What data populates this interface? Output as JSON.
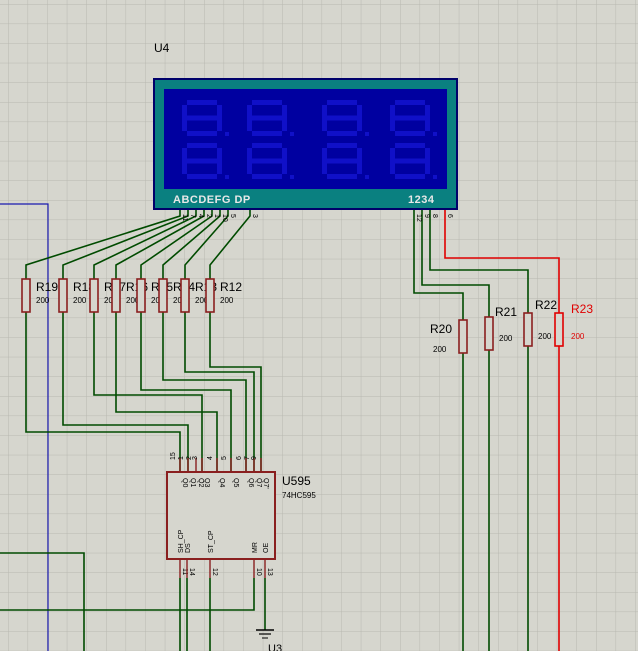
{
  "colors": {
    "background": "#d6d6ce",
    "grid": "#b8b8b0",
    "wire": "#004b00",
    "wire_red": "#e00000",
    "component": "#8a1f1f",
    "text": "#000000",
    "lcd_frame": "#0a8080",
    "lcd_screen": "#0000a0",
    "lcd_segment": "#1010c8",
    "lcd_label": "#e8e8e8",
    "blue_line": "#1a1ab0"
  },
  "display": {
    "ref": "U4",
    "segment_label": "ABCDEFG DP",
    "digit_label": "1234",
    "segment_pins": [
      "11",
      "7",
      "4",
      "2",
      "1",
      "10",
      "5",
      "3"
    ],
    "digit_pins": [
      "12",
      "9",
      "8",
      "6"
    ]
  },
  "resistors": [
    {
      "ref": "R19",
      "value": "200"
    },
    {
      "ref": "R18",
      "value": "200"
    },
    {
      "ref": "R17",
      "value": "200"
    },
    {
      "ref": "R16",
      "value": "200"
    },
    {
      "ref": "R15",
      "value": "200"
    },
    {
      "ref": "R14",
      "value": "200"
    },
    {
      "ref": "R13",
      "value": "200"
    },
    {
      "ref": "R12",
      "value": "200"
    },
    {
      "ref": "R20",
      "value": "200"
    },
    {
      "ref": "R21",
      "value": "200"
    },
    {
      "ref": "R22",
      "value": "200"
    },
    {
      "ref": "R23",
      "value": "200"
    }
  ],
  "chip": {
    "ref": "U595",
    "part": "74HC595",
    "top_pins": [
      {
        "num": "15",
        "name": "Q0"
      },
      {
        "num": "1",
        "name": "Q1"
      },
      {
        "num": "2",
        "name": "Q2"
      },
      {
        "num": "3",
        "name": "Q3"
      },
      {
        "num": "4",
        "name": "Q4"
      },
      {
        "num": "5",
        "name": "Q5"
      },
      {
        "num": "6",
        "name": "Q6"
      },
      {
        "num": "7",
        "name": "Q7"
      },
      {
        "num": "9",
        "name": "Q7'"
      }
    ],
    "bottom_pins": [
      {
        "num": "11",
        "name": "SH_CP"
      },
      {
        "num": "14",
        "name": "DS"
      },
      {
        "num": "12",
        "name": "ST_CP"
      },
      {
        "num": "10",
        "name": "MR"
      },
      {
        "num": "13",
        "name": "OE"
      }
    ]
  },
  "partial_label": "U3"
}
